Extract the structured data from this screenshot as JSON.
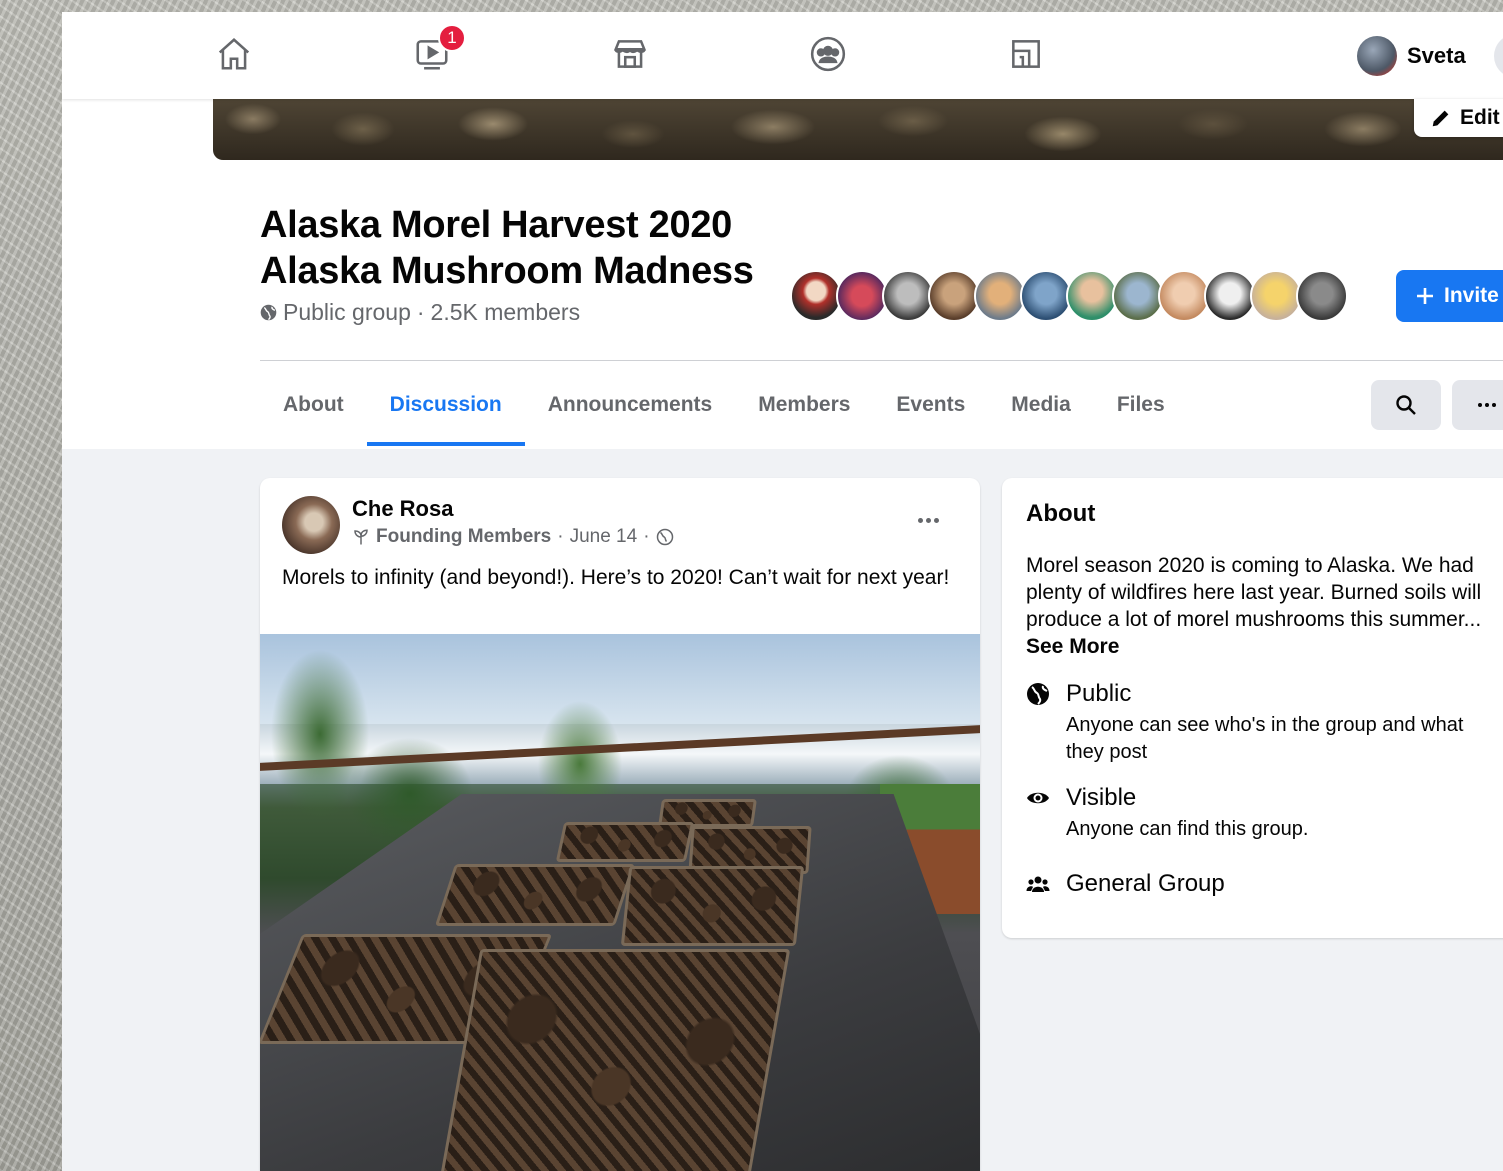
{
  "nav": {
    "watch_badge": "1",
    "profile_name": "Sveta"
  },
  "cover": {
    "edit_label": "Edit"
  },
  "group": {
    "title_line1": "Alaska Morel Harvest 2020",
    "title_line2": "Alaska Mushroom Madness",
    "privacy": "Public group",
    "separator": "·",
    "members": "2.5K members",
    "invite_label": "Invite"
  },
  "tabs": [
    {
      "label": "About"
    },
    {
      "label": "Discussion"
    },
    {
      "label": "Announcements"
    },
    {
      "label": "Members"
    },
    {
      "label": "Events"
    },
    {
      "label": "Media"
    },
    {
      "label": "Files"
    }
  ],
  "post": {
    "author": "Che Rosa",
    "role": "Founding Members",
    "dot": "·",
    "date": "June 14",
    "text": "Morels to infinity (and beyond!). Here’s to 2020! Can’t wait for next year!"
  },
  "about": {
    "title": "About",
    "description": "Morel season 2020 is coming to Alaska. We had plenty of wildfires here last year. Burned soils will produce a lot of morel mushrooms this summer...",
    "see_more": "See More",
    "public_label": "Public",
    "public_desc": "Anyone can see who's in the group and what they post",
    "visible_label": "Visible",
    "visible_desc": "Anyone can find this group.",
    "type_label": "General Group"
  },
  "colors": {
    "accent": "#1877f2",
    "badge": "#e41e3f",
    "secondary_text": "#65676b"
  }
}
